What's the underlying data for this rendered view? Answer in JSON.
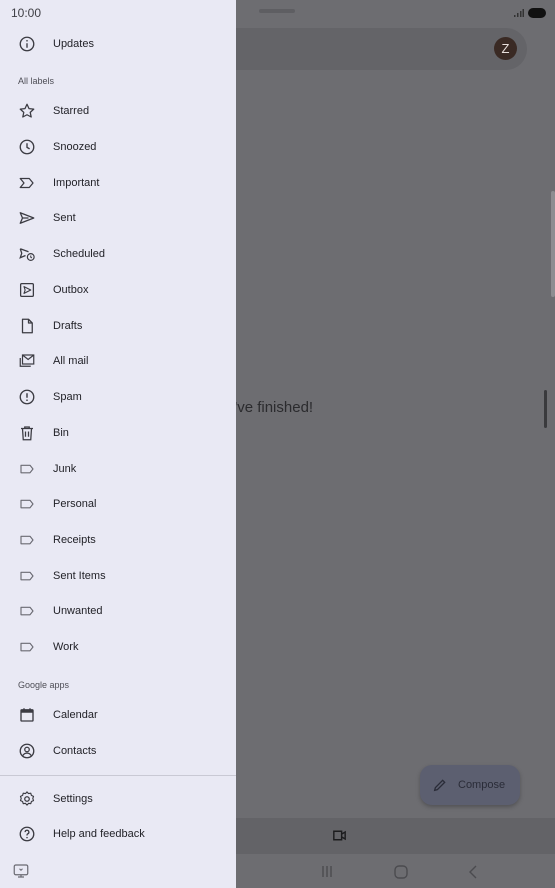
{
  "status": {
    "time": "10:00"
  },
  "drawer": {
    "top_item": {
      "label": "Updates",
      "icon": "info-icon"
    },
    "sections": {
      "all_labels": "All labels",
      "google_apps": "Google apps"
    },
    "labels": [
      {
        "label": "Starred",
        "icon": "star-icon"
      },
      {
        "label": "Snoozed",
        "icon": "clock-icon"
      },
      {
        "label": "Important",
        "icon": "important-icon"
      },
      {
        "label": "Sent",
        "icon": "send-icon"
      },
      {
        "label": "Scheduled",
        "icon": "scheduled-send-icon"
      },
      {
        "label": "Outbox",
        "icon": "outbox-icon"
      },
      {
        "label": "Drafts",
        "icon": "draft-icon"
      },
      {
        "label": "All mail",
        "icon": "all-mail-icon"
      },
      {
        "label": "Spam",
        "icon": "spam-icon"
      },
      {
        "label": "Bin",
        "icon": "trash-icon"
      },
      {
        "label": "Junk",
        "icon": "label-icon"
      },
      {
        "label": "Personal",
        "icon": "label-icon"
      },
      {
        "label": "Receipts",
        "icon": "label-icon"
      },
      {
        "label": "Sent Items",
        "icon": "label-icon"
      },
      {
        "label": "Unwanted",
        "icon": "label-icon"
      },
      {
        "label": "Work",
        "icon": "label-icon"
      }
    ],
    "apps": [
      {
        "label": "Calendar",
        "icon": "calendar-icon"
      },
      {
        "label": "Contacts",
        "icon": "contacts-icon"
      }
    ],
    "footer": [
      {
        "label": "Settings",
        "icon": "gear-icon"
      },
      {
        "label": "Help and feedback",
        "icon": "help-icon"
      }
    ]
  },
  "background": {
    "avatar_letter": "Z",
    "empty_message": "u've finished!",
    "compose_label": "Compose"
  }
}
